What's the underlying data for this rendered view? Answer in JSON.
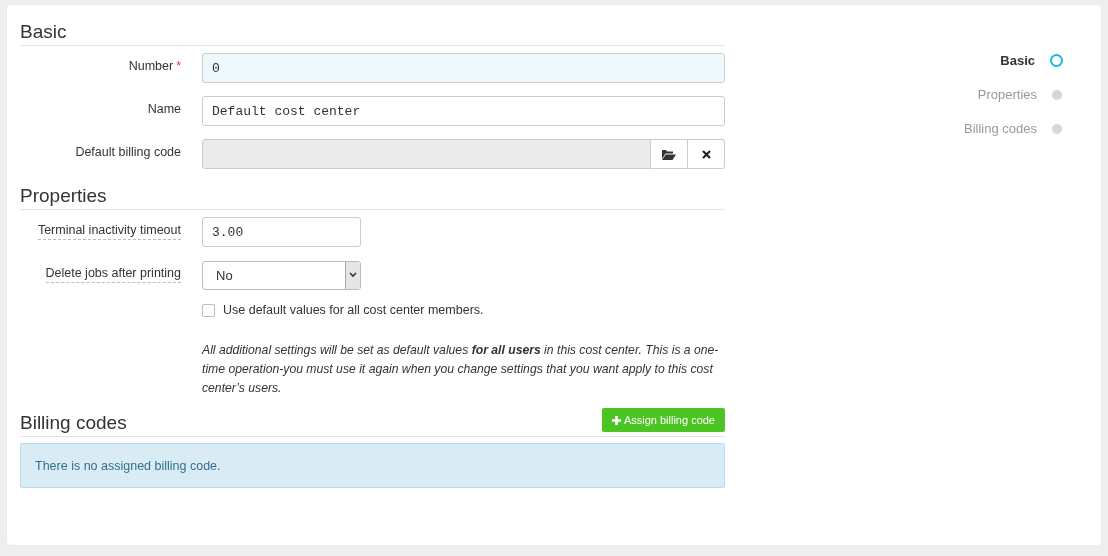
{
  "basic": {
    "title": "Basic",
    "fields": [
      {
        "kind": "text",
        "label": "Number",
        "required_mark": "*",
        "help": false,
        "focused": true,
        "value": "0"
      },
      {
        "kind": "text",
        "label": "Name",
        "help": false,
        "focused": false,
        "value": "Default cost center"
      },
      {
        "kind": "picker",
        "label": "Default billing code",
        "help": false
      }
    ]
  },
  "properties": {
    "title": "Properties",
    "fields": [
      {
        "kind": "short",
        "label": "Terminal inactivity timeout",
        "help": true,
        "focused": false,
        "value": "3.00"
      },
      {
        "kind": "select",
        "label": "Delete jobs after printing",
        "help": true,
        "value": "No"
      }
    ],
    "checkbox": {
      "label": "Use default values for all cost center members.",
      "checked": false
    },
    "note": "All additional settings will be set as default values **for all users** in this cost center. This is a one-time operation-you must use it again when you change settings that you want apply to this cost center’s users."
  },
  "billing": {
    "title": "Billing codes",
    "button": "Assign billing code",
    "alert": "There is no assigned billing code."
  },
  "nav": [
    {
      "label": "Basic",
      "selected": true
    },
    {
      "label": "Properties",
      "selected": false
    },
    {
      "label": "Billing codes",
      "selected": false
    }
  ]
}
